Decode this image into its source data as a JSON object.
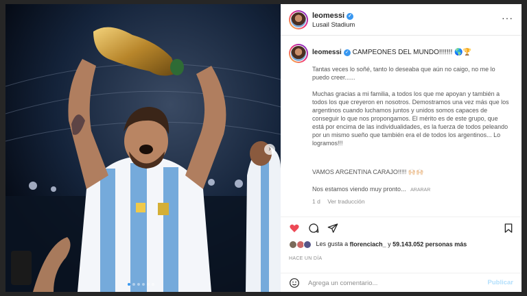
{
  "post": {
    "username": "leomessi",
    "location": "Lusail Stadium",
    "more_label": "···",
    "headline": "CAMPEONES DEL MUNDO!!!!!!!",
    "headline_emoji": "🌎🏆",
    "paragraphs": [
      "Tantas veces lo soñé, tanto lo deseaba que aún no caigo, no me lo puedo creer......",
      "Muchas gracias a mi familia, a todos los que me apoyan y también a todos los que creyeron en nosotros. Demostramos una vez más que los argentinos cuando luchamos juntos y unidos somos capaces de conseguir lo que nos propongamos. El mérito es de este grupo, que está por encima de las individualidades, es la fuerza de todos peleando por un mismo sueño que también era el de todos los argentinos... Lo logramos!!!",
      "VAMOS ARGENTINA CARAJO!!!!! 🙌🏻🙌🏻",
      "Nos estamos viendo muy pronto..."
    ],
    "translate_inline": "ARARAR",
    "age": "1 d",
    "see_translation": "Ver traducción"
  },
  "likes": {
    "prefix": "Les gusta a",
    "first_user": "florenciach_",
    "joiner": "y",
    "count": "59.143.052 personas más"
  },
  "timestamp": "HACE UN DÍA",
  "comment": {
    "placeholder": "Agrega un comentario...",
    "publish_label": "Publicar"
  },
  "colors": {
    "heart": "#ed4956",
    "link": "#3897f0",
    "publish_disabled": "#b2dffc"
  },
  "icons": [
    "heart-icon",
    "comment-icon",
    "share-icon",
    "bookmark-icon",
    "emoji-icon",
    "next-arrow-icon",
    "more-options-icon",
    "verified-icon"
  ]
}
